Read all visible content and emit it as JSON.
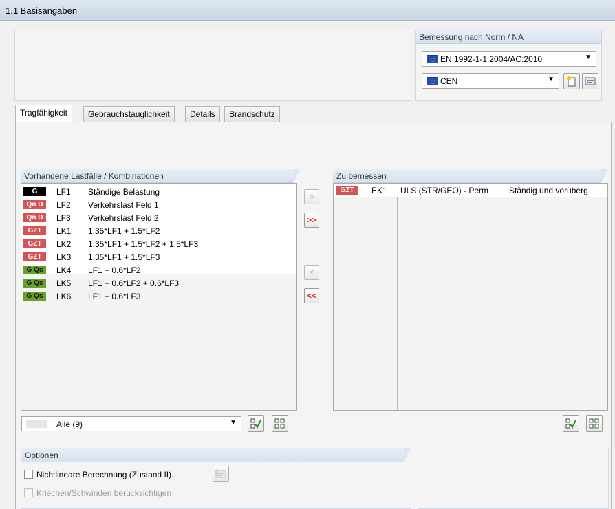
{
  "header": {
    "title": "1.1 Basisangaben"
  },
  "norm": {
    "label": "Bemessung nach Norm / NA",
    "standard": "EN 1992-1-1:2004/AC:2010",
    "national_annex": "CEN"
  },
  "tabs": [
    {
      "label": "Tragfähigkeit",
      "active": true
    },
    {
      "label": "Gebrauchstauglichkeit"
    },
    {
      "label": "Details"
    },
    {
      "label": "Brandschutz"
    }
  ],
  "available": {
    "label": "Vorhandene Lastfälle / Kombinationen",
    "items": [
      {
        "badge": "G",
        "badge_color": "#000000",
        "name": "LF1",
        "desc": "Ständige Belastung"
      },
      {
        "badge": "Qn D",
        "badge_color": "#d45454",
        "name": "LF2",
        "desc": "Verkehrslast Feld 1"
      },
      {
        "badge": "Qn D",
        "badge_color": "#d45454",
        "name": "LF3",
        "desc": "Verkehrslast Feld 2"
      },
      {
        "badge": "GZT",
        "badge_color": "#d45454",
        "name": "LK1",
        "desc": "1.35*LF1 + 1.5*LF2"
      },
      {
        "badge": "GZT",
        "badge_color": "#d45454",
        "name": "LK2",
        "desc": "1.35*LF1 + 1.5*LF2 + 1.5*LF3"
      },
      {
        "badge": "GZT",
        "badge_color": "#d45454",
        "name": "LK3",
        "desc": "1.35*LF1 + 1.5*LF3"
      },
      {
        "badge": "G Qs",
        "badge_color": "#69a028",
        "name": "LK4",
        "desc": "LF1 + 0.6*LF2"
      },
      {
        "badge": "G Qs",
        "badge_color": "#69a028",
        "name": "LK5",
        "desc": "LF1 + 0.6*LF2 + 0.6*LF3"
      },
      {
        "badge": "G Qs",
        "badge_color": "#69a028",
        "name": "LK6",
        "desc": "LF1 + 0.6*LF3"
      }
    ],
    "filter": "Alle (9)"
  },
  "selected": {
    "label": "Zu bemessen",
    "items": [
      {
        "badge": "GZT",
        "badge_color": "#d45454",
        "name": "EK1",
        "type": "ULS (STR/GEO) - Perm",
        "situation": "Ständig und vorüberg"
      }
    ]
  },
  "arrows": {
    "add": ">",
    "add_all": ">>",
    "remove": "<",
    "remove_all": "<<"
  },
  "options": {
    "label": "Optionen",
    "nonlinear": "Nichtlineare Berechnung (Zustand II)...",
    "creep": "Kriechen/Schwinden berücksichtigen"
  }
}
